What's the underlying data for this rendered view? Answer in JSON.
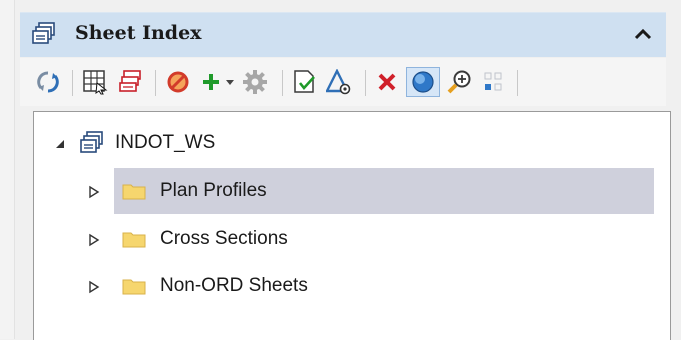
{
  "panel": {
    "title": "Sheet Index",
    "header_bg": "#cfe0f1"
  },
  "toolbar": {
    "buttons": [
      {
        "name": "refresh-icon"
      },
      {
        "name": "sheet-grid-icon"
      },
      {
        "name": "sheets-stack-icon"
      },
      {
        "name": "disable-circle-icon"
      },
      {
        "name": "add-plus-icon"
      },
      {
        "name": "dropdown-arrow-icon"
      },
      {
        "name": "settings-gear-icon"
      },
      {
        "name": "checked-document-icon"
      },
      {
        "name": "triangle-view-icon"
      },
      {
        "name": "delete-x-icon"
      },
      {
        "name": "globe-icon"
      },
      {
        "name": "zoom-in-icon"
      },
      {
        "name": "grid-dots-icon"
      }
    ]
  },
  "tree": {
    "root": {
      "label": "INDOT_WS",
      "expanded": true
    },
    "items": [
      {
        "label": "Plan Profiles",
        "selected": true
      },
      {
        "label": "Cross Sections",
        "selected": false
      },
      {
        "label": "Non-ORD Sheets",
        "selected": false
      }
    ],
    "selection_color": "#cfd0dc",
    "folder_color": "#f6d66e"
  }
}
